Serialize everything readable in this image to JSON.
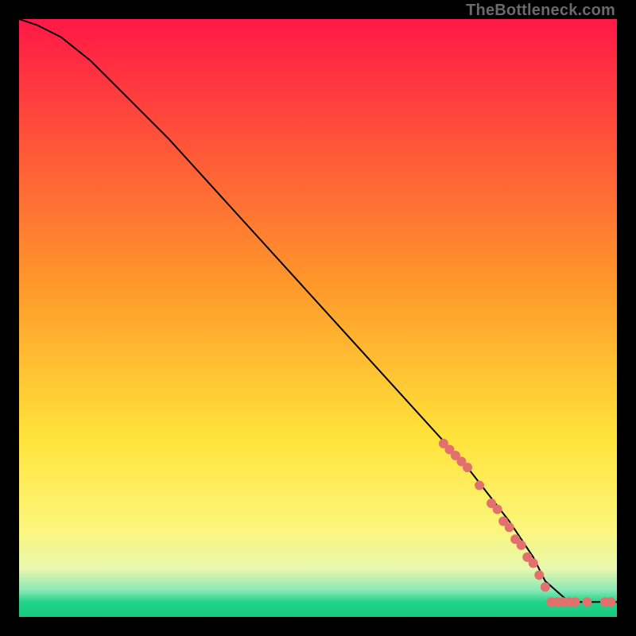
{
  "watermark": "TheBottleneck.com",
  "chart_data": {
    "type": "line",
    "title": "",
    "xlabel": "",
    "ylabel": "",
    "xlim": [
      0,
      100
    ],
    "ylim": [
      0,
      100
    ],
    "gradient_stops": [
      {
        "offset": 0.0,
        "color": "#ff1846"
      },
      {
        "offset": 0.45,
        "color": "#ff9a2a"
      },
      {
        "offset": 0.7,
        "color": "#ffe33a"
      },
      {
        "offset": 0.85,
        "color": "#fcf67a"
      },
      {
        "offset": 0.92,
        "color": "#e7f7ac"
      },
      {
        "offset": 0.955,
        "color": "#8de8b8"
      },
      {
        "offset": 0.975,
        "color": "#22d38b"
      },
      {
        "offset": 1.0,
        "color": "#18c97f"
      }
    ],
    "series": [
      {
        "name": "curve",
        "color": "#000000",
        "x": [
          0,
          3,
          7,
          12,
          18,
          25,
          35,
          45,
          55,
          65,
          75,
          82,
          86,
          88,
          92,
          97,
          100
        ],
        "y": [
          100,
          99,
          97,
          93,
          87,
          80,
          69,
          58,
          47,
          36,
          25,
          16,
          10,
          6,
          2.5,
          2.5,
          2.5
        ]
      }
    ],
    "markers": {
      "color": "#e2716e",
      "radius": 6,
      "points": [
        {
          "x": 71,
          "y": 29
        },
        {
          "x": 72,
          "y": 28
        },
        {
          "x": 73,
          "y": 27
        },
        {
          "x": 74,
          "y": 26
        },
        {
          "x": 75,
          "y": 25
        },
        {
          "x": 77,
          "y": 22
        },
        {
          "x": 79,
          "y": 19
        },
        {
          "x": 80,
          "y": 18
        },
        {
          "x": 81,
          "y": 16
        },
        {
          "x": 82,
          "y": 15
        },
        {
          "x": 83,
          "y": 13
        },
        {
          "x": 84,
          "y": 12
        },
        {
          "x": 85,
          "y": 10
        },
        {
          "x": 86,
          "y": 9
        },
        {
          "x": 87,
          "y": 7
        },
        {
          "x": 88,
          "y": 5
        },
        {
          "x": 89,
          "y": 2.5
        },
        {
          "x": 90,
          "y": 2.5
        },
        {
          "x": 91,
          "y": 2.5
        },
        {
          "x": 92,
          "y": 2.5
        },
        {
          "x": 93,
          "y": 2.5
        },
        {
          "x": 95,
          "y": 2.5
        },
        {
          "x": 98,
          "y": 2.5
        },
        {
          "x": 99,
          "y": 2.5
        }
      ]
    }
  }
}
